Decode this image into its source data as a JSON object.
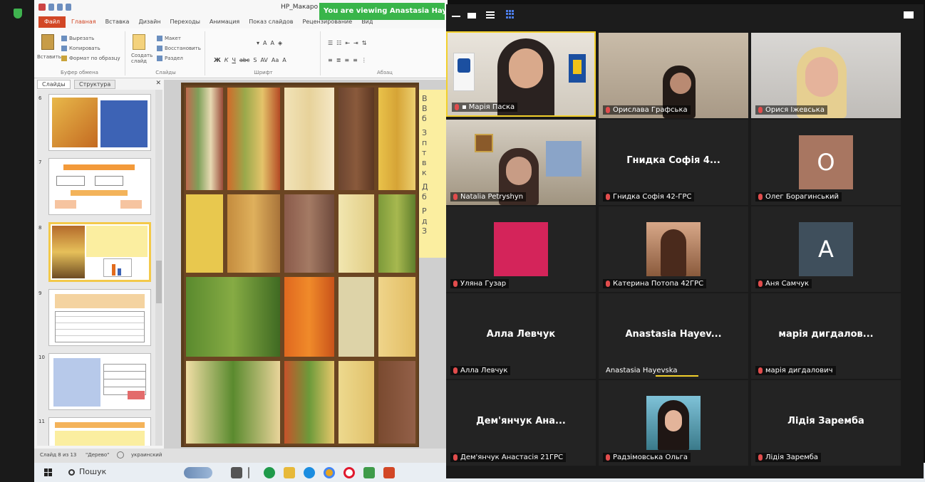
{
  "ppt": {
    "doc_title": "НР_Макаро",
    "file_tab": "Файл",
    "tabs": [
      "Главная",
      "Вставка",
      "Дизайн",
      "Переходы",
      "Анимация",
      "Показ слайдов",
      "Рецензирование",
      "Вид"
    ],
    "clipboard": {
      "paste": "Вставить",
      "cut": "Вырезать",
      "copy": "Копировать",
      "format": "Формат по образцу",
      "group": "Буфер обмена"
    },
    "slides_group": {
      "create": "Создать слайд",
      "layout": "Макет",
      "reset": "Восстановить",
      "section": "Раздел",
      "group": "Слайды"
    },
    "font_group": "Шрифт",
    "paragraph_group": "Абзац",
    "panel_tabs": [
      "Слайды",
      "Структура"
    ],
    "slide_numbers": [
      "6",
      "7",
      "8",
      "9",
      "10",
      "11"
    ],
    "yellow_text": [
      "В",
      "В",
      "б",
      "З",
      "п",
      "т",
      "в",
      "к",
      "Д",
      "б",
      "Р",
      "д",
      "З"
    ],
    "status": {
      "slide": "Слайд 8 из 13",
      "theme": "\"Дерево\"",
      "lang": "украинский"
    }
  },
  "taskbar": {
    "search": "Пошук"
  },
  "zoom": {
    "banner": "You are viewing Anastasia Haye",
    "participants": [
      {
        "name": "Марія Паска"
      },
      {
        "name": "Орислава Графська"
      },
      {
        "name": "Орися Іжевська"
      },
      {
        "name": "Natalia Petryshyn"
      },
      {
        "center": "Гнидка Софія 4...",
        "name": "Гнидка Софія 42-ГРС"
      },
      {
        "avatar": "О",
        "name": "Олег Борагинський"
      },
      {
        "name": "Уляна Гузар"
      },
      {
        "name": "Катерина Потопа 42ГРС"
      },
      {
        "avatar": "А",
        "name": "Аня Самчук"
      },
      {
        "center": "Алла Левчук",
        "name": "Алла Левчук"
      },
      {
        "center": "Anastasia Hayev...",
        "name": "Anastasia Hayevska"
      },
      {
        "center": "марія дигдалов...",
        "name": "марія дигдалович"
      },
      {
        "center": "Дем'янчук Ана...",
        "name": "Дем'янчук Анастасія 21ГРС"
      },
      {
        "name": "Радзімовська Ольга"
      },
      {
        "center": "Лідія Заремба",
        "name": "Лідія Заремба"
      }
    ]
  },
  "colors": {
    "ppt_accent": "#d24726",
    "zoom_banner": "#39b54a",
    "speaker_border": "#f2d02b",
    "avatar_o": "#a87661",
    "avatar_a": "#3f4f5c",
    "pink": "#d4245a"
  }
}
